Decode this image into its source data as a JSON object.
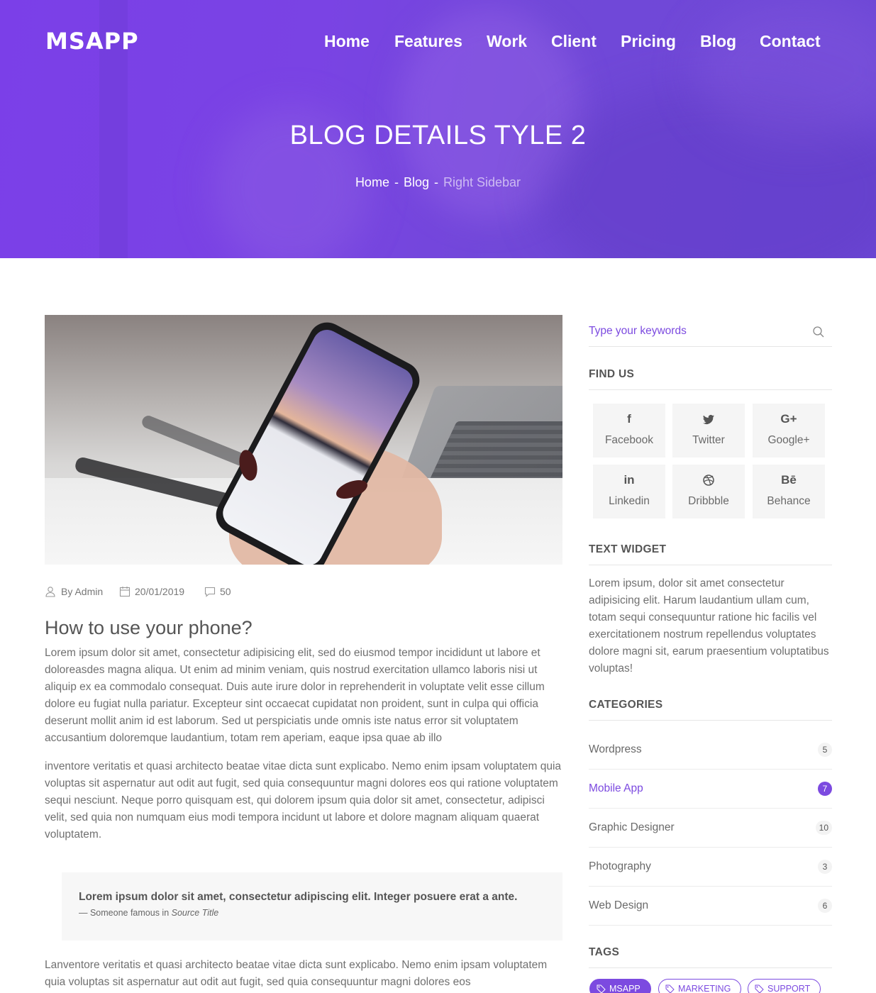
{
  "brand": {
    "logo": "MSAPP"
  },
  "nav": {
    "items": [
      {
        "label": "Home"
      },
      {
        "label": "Features"
      },
      {
        "label": "Work"
      },
      {
        "label": "Client"
      },
      {
        "label": "Pricing"
      },
      {
        "label": "Blog"
      },
      {
        "label": "Contact"
      }
    ]
  },
  "hero": {
    "title": "BLOG DETAILS TYLE 2",
    "breadcrumb": [
      {
        "label": "Home"
      },
      {
        "label": "Blog"
      },
      {
        "label": "Right Sidebar"
      }
    ],
    "separator": "-"
  },
  "post": {
    "author": "By Admin",
    "date": "20/01/2019",
    "comments": "50",
    "title": "How to use your phone?",
    "paragraphs": [
      "Lorem ipsum dolor sit amet, consectetur adipisicing elit, sed do eiusmod tempor incididunt ut labore et doloreasdes magna aliqua. Ut enim ad minim veniam, quis nostrud exercitation ullamco laboris nisi ut aliquip ex ea commodalo consequat. Duis aute irure dolor in reprehenderit in voluptate velit esse cillum dolore eu fugiat nulla pariatur. Excepteur sint occaecat cupidatat non proident, sunt in culpa qui officia deserunt mollit anim id est laborum. Sed ut perspiciatis unde omnis iste natus error sit voluptatem accusantium doloremque laudantium, totam rem aperiam, eaque ipsa quae ab illo",
      "inventore veritatis et quasi architecto beatae vitae dicta sunt explicabo. Nemo enim ipsam voluptatem quia voluptas sit aspernatur aut odit aut fugit, sed quia consequuntur magni dolores eos qui ratione voluptatem sequi nesciunt. Neque porro quisquam est, qui dolorem ipsum quia dolor sit amet, consectetur, adipisci velit, sed quia non numquam eius modi tempora incidunt ut labore et dolore magnam aliquam quaerat voluptatem.",
      "Lanventore veritatis et quasi architecto beatae vitae dicta sunt explicabo. Nemo enim ipsam voluptatem quia voluptas sit aspernatur aut odit aut fugit, sed quia consequuntur magni dolores eos"
    ],
    "quote": {
      "text": "Lorem ipsum dolor sit amet, consectetur adipiscing elit. Integer posuere erat a ante.",
      "source_prefix": "— Someone famous in ",
      "source_title": "Source Title"
    }
  },
  "sidebar": {
    "search": {
      "placeholder": "Type your keywords"
    },
    "find_us": {
      "title": "FIND US",
      "items": [
        {
          "label": "Facebook",
          "glyph": "f",
          "icon": "facebook-icon"
        },
        {
          "label": "Twitter",
          "glyph": "",
          "icon": "twitter-icon"
        },
        {
          "label": "Google+",
          "glyph": "G+",
          "icon": "google-plus-icon"
        },
        {
          "label": "Linkedin",
          "glyph": "in",
          "icon": "linkedin-icon"
        },
        {
          "label": "Dribbble",
          "glyph": "",
          "icon": "dribbble-icon"
        },
        {
          "label": "Behance",
          "glyph": "Bē",
          "icon": "behance-icon"
        }
      ]
    },
    "text_widget": {
      "title": "TEXT WIDGET",
      "body": "Lorem ipsum, dolor sit amet consectetur adipisicing elit. Harum laudantium ullam cum, totam sequi consequuntur ratione hic facilis vel exercitationem nostrum repellendus voluptates dolore magni sit, earum praesentium voluptatibus voluptas!"
    },
    "categories": {
      "title": "CATEGORIES",
      "items": [
        {
          "name": "Wordpress",
          "count": "5"
        },
        {
          "name": "Mobile App",
          "count": "7",
          "active": true
        },
        {
          "name": "Graphic Designer",
          "count": "10"
        },
        {
          "name": "Photography",
          "count": "3"
        },
        {
          "name": "Web Design",
          "count": "6"
        }
      ]
    },
    "tags": {
      "title": "TAGS",
      "items": [
        {
          "label": "MSAPP",
          "active": true
        },
        {
          "label": "MARKETING"
        },
        {
          "label": "SUPPORT"
        }
      ]
    }
  },
  "colors": {
    "accent": "#7c4ae0",
    "hero": "#7a43e4"
  }
}
